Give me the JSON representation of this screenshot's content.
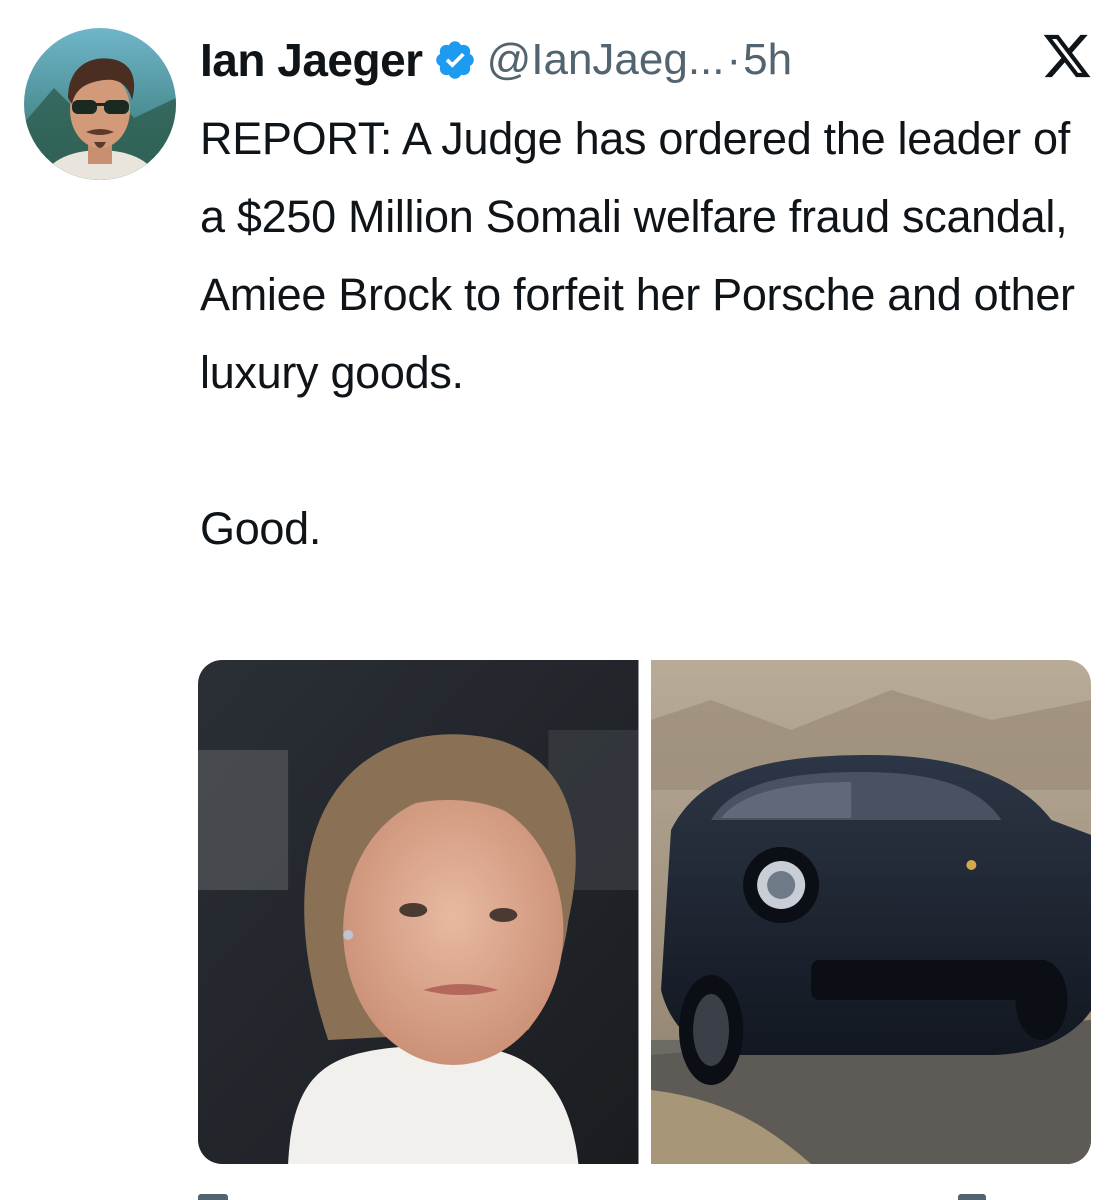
{
  "author": {
    "display_name": "Ian Jaeger",
    "handle": "@IanJaeg...",
    "separator": "·",
    "time": "5h",
    "verified_icon": "verified-badge-icon",
    "avatar": "avatar-illustration"
  },
  "platform_icon": "x-logo-icon",
  "tweet": {
    "text_paragraph_1": "REPORT: A Judge has ordered the leader of a $250 Million Somali welfare fraud scandal, Amiee Brock to forfeit her Porsche and other luxury goods.",
    "text_paragraph_2": "Good."
  },
  "media": [
    {
      "name": "photo-woman",
      "kind": "photo"
    },
    {
      "name": "photo-porsche",
      "kind": "photo"
    }
  ],
  "colors": {
    "text_primary": "#0f1419",
    "text_secondary": "#536471",
    "verified_blue": "#1d9bf0"
  }
}
